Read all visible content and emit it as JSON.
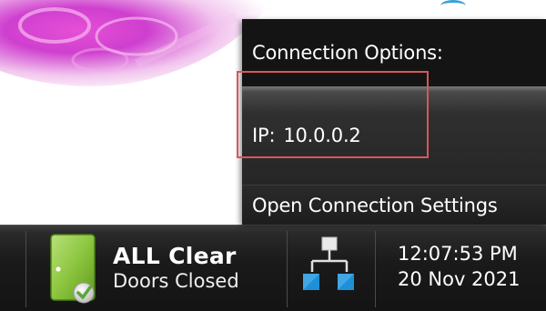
{
  "popup": {
    "header": "Connection Options:",
    "ip_label": "IP:",
    "ip_value": "10.0.0.2",
    "open_settings": "Open Connection Settings"
  },
  "taskbar": {
    "status_title": "ALL Clear",
    "status_subtitle": "Doors Closed",
    "clock_time": "12:07:53 PM",
    "clock_date": "20 Nov 2021"
  },
  "icons": {
    "door": "door-closed-check-icon",
    "network": "network-connection-icon"
  },
  "colors": {
    "highlight_box": "#d7575a",
    "door_green": "#8cc63f",
    "network_blue": "#1e90d6"
  }
}
